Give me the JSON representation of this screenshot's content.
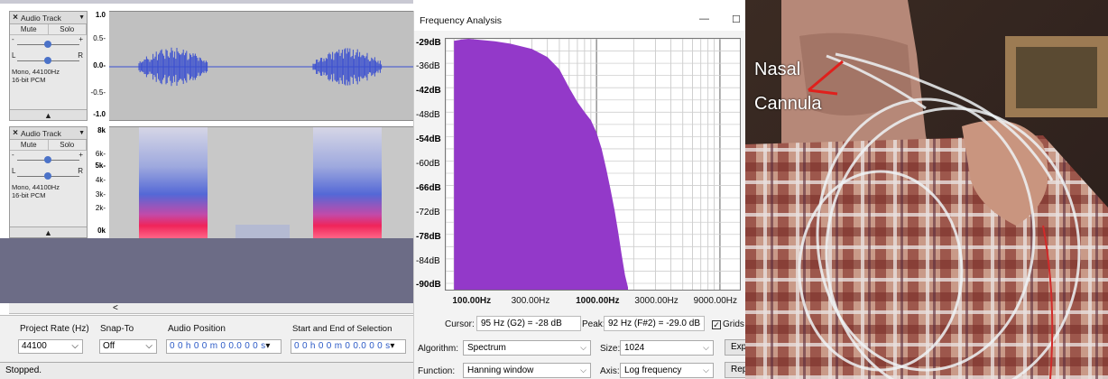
{
  "audacity": {
    "tracks": [
      {
        "close": "×",
        "name": "Audio Track",
        "menu": "▼",
        "mute": "Mute",
        "solo": "Solo",
        "gain_minus": "-",
        "gain_plus": "+",
        "pan_left": "L",
        "pan_right": "R",
        "format_line1": "Mono, 44100Hz",
        "format_line2": "16-bit PCM",
        "collapse": "▲"
      },
      {
        "close": "×",
        "name": "Audio Track",
        "menu": "▼",
        "mute": "Mute",
        "solo": "Solo",
        "gain_minus": "-",
        "gain_plus": "+",
        "pan_left": "L",
        "pan_right": "R",
        "format_line1": "Mono, 44100Hz",
        "format_line2": "16-bit PCM",
        "collapse": "▲"
      }
    ],
    "waveform_ruler": [
      "1.0",
      "0.5-",
      "0.0-",
      "-0.5-",
      "-1.0"
    ],
    "spectrogram_ruler": [
      "8k",
      "6k-",
      "5k-",
      "4k-",
      "3k-",
      "2k-",
      "0k"
    ],
    "scroll_left": "<",
    "selection_toolbar": {
      "project_rate_label": "Project Rate (Hz)",
      "project_rate_value": "44100",
      "snap_to_label": "Snap-To",
      "snap_to_value": "Off",
      "audio_position_label": "Audio Position",
      "audio_position_value": "0 0 h 0 0 m 0 0.0 0 0 s",
      "selection_label": "Start and End of Selection",
      "selection_value": "0 0 h 0 0 m 0 0.0 0 0 s",
      "dropdown_glyph": "▾"
    },
    "status": "Stopped."
  },
  "frequency_analysis": {
    "title": "Frequency Analysis",
    "minimize": "—",
    "maximize": "☐",
    "db_labels": [
      "-29dB",
      "-36dB",
      "-42dB",
      "-48dB",
      "-54dB",
      "-60dB",
      "-66dB",
      "-72dB",
      "-78dB",
      "-84dB",
      "-90dB"
    ],
    "hz_labels": [
      {
        "text": "100.00Hz",
        "bold": true
      },
      {
        "text": "300.00Hz",
        "bold": false
      },
      {
        "text": "1000.00Hz",
        "bold": true
      },
      {
        "text": "3000.00Hz",
        "bold": false
      },
      {
        "text": "9000.00Hz",
        "bold": false
      }
    ],
    "cursor_label": "Cursor:",
    "cursor_value": "95 Hz (G2) = -28 dB",
    "peak_label": "Peak:",
    "peak_value": "92 Hz (F#2) = -29.0 dB",
    "grids_label": "Grids",
    "grids_checked": "✓",
    "algorithm_label": "Algorithm:",
    "algorithm_value": "Spectrum",
    "size_label": "Size:",
    "size_value": "1024",
    "function_label": "Function:",
    "function_value": "Hanning window",
    "axis_label": "Axis:",
    "axis_value": "Log frequency",
    "export_button": "Exp",
    "replot_button": "Rep",
    "chevron": "⌵",
    "fill_color": "#9339c9"
  },
  "chart_data": {
    "type": "area",
    "title": "Frequency Analysis",
    "xlabel": "",
    "ylabel": "",
    "x_scale": "log",
    "x_unit": "Hz",
    "y_unit": "dB",
    "ylim": [
      -90,
      -29
    ],
    "grid": true,
    "x": [
      70,
      80,
      92,
      100,
      150,
      200,
      300,
      400,
      500,
      600,
      700,
      800,
      900,
      1000,
      1100,
      1200,
      1300,
      1400,
      1500,
      1600,
      1700,
      1800
    ],
    "y": [
      -29.5,
      -29.2,
      -29.0,
      -29.1,
      -29.6,
      -30.2,
      -31.5,
      -33.5,
      -36.5,
      -41.0,
      -44.5,
      -47.0,
      -49.0,
      -52.0,
      -56.0,
      -61.0,
      -66.0,
      -71.0,
      -76.5,
      -82.0,
      -87.0,
      -90.0
    ]
  },
  "photo": {
    "label_line1": "Nasal",
    "label_line2": "Cannula",
    "arrow_color": "#e0201c"
  }
}
